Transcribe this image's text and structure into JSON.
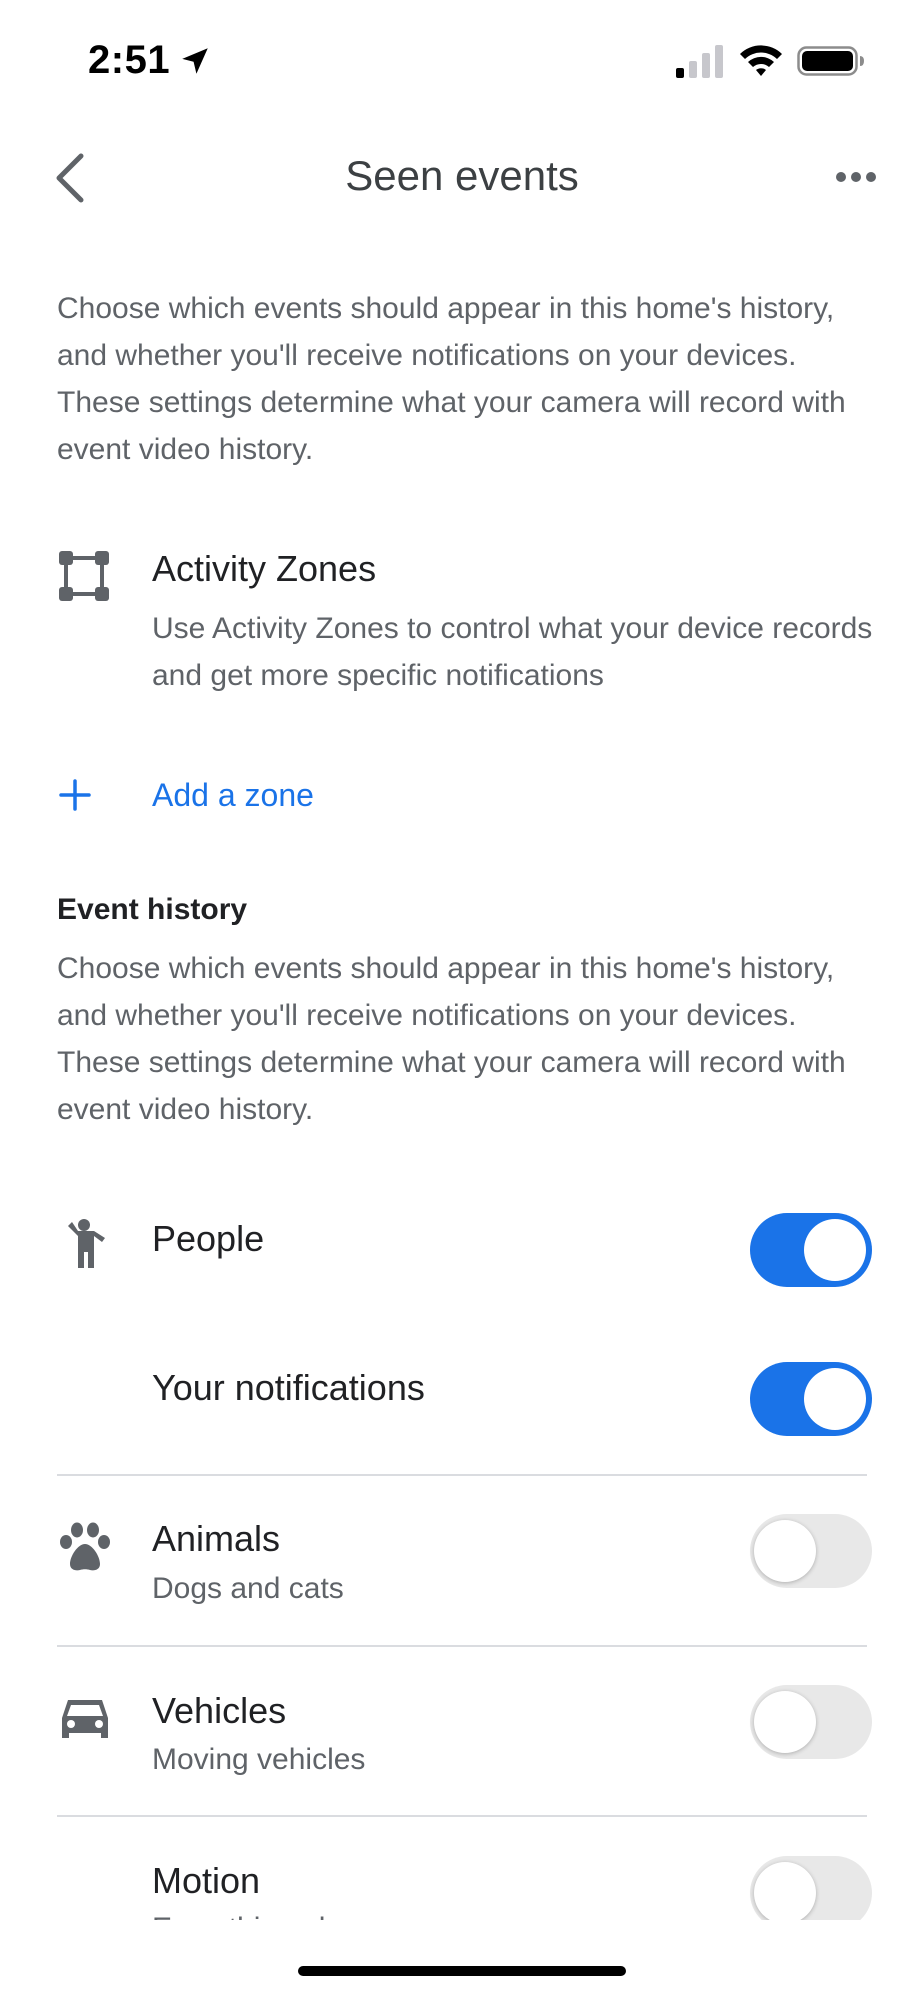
{
  "status_bar": {
    "time": "2:51"
  },
  "header": {
    "title": "Seen events"
  },
  "intro_text": "Choose which events should appear in this home's history, and whether you'll receive notifications on your devices. These settings determine what your camera will record with event video history.",
  "activity_zones": {
    "title": "Activity Zones",
    "description": "Use Activity Zones to control what your device records and get more specific notifications",
    "add_zone_label": "Add a zone"
  },
  "event_history": {
    "title": "Event history",
    "description": "Choose which events should appear in this home's history, and whether you'll receive notifications on your devices. These settings determine what your camera will record with event video history."
  },
  "rows": [
    {
      "title": "People",
      "subtitle": "",
      "icon": "person-icon",
      "enabled": true
    },
    {
      "title": "Your notifications",
      "subtitle": "",
      "icon": "",
      "enabled": true
    },
    {
      "title": "Animals",
      "subtitle": "Dogs and cats",
      "icon": "paw-icon",
      "enabled": false
    },
    {
      "title": "Vehicles",
      "subtitle": "Moving vehicles",
      "icon": "car-icon",
      "enabled": false
    },
    {
      "title": "Motion",
      "subtitle": "Everything else",
      "icon": "",
      "enabled": false
    }
  ],
  "colors": {
    "accent": "#1a73e8",
    "text_primary": "#202124",
    "text_secondary": "#5f6368",
    "divider": "#dadce0"
  }
}
